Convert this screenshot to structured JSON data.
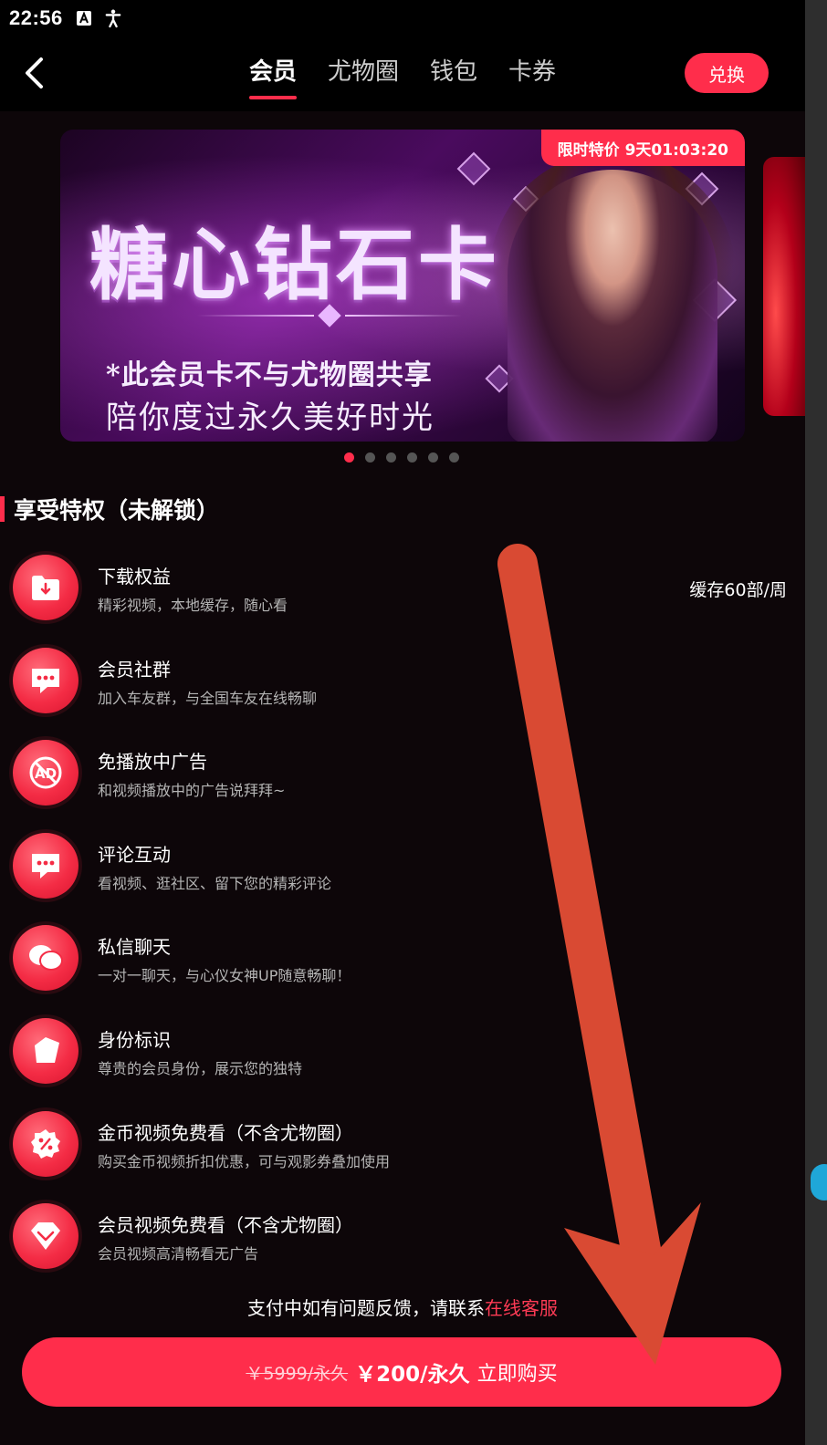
{
  "status_bar": {
    "time": "22:56",
    "icons": [
      "font-icon",
      "accessibility-icon"
    ]
  },
  "header": {
    "tabs": [
      {
        "label": "会员",
        "active": true
      },
      {
        "label": "尤物圈",
        "active": false
      },
      {
        "label": "钱包",
        "active": false
      },
      {
        "label": "卡券",
        "active": false
      }
    ],
    "redeem_label": "兑换"
  },
  "banner": {
    "promo_badge": "限时特价 9天01:03:20",
    "title": "糖心钻石卡",
    "line1": "*此会员卡不与尤物圈共享",
    "line2": "陪你度过永久美好时光",
    "dot_count": 6,
    "active_dot": 0
  },
  "privileges": {
    "section_title": "享受特权（未解锁）",
    "items": [
      {
        "title": "下载权益",
        "desc": "精彩视频，本地缓存，随心看",
        "extra": "缓存60部/周",
        "icon": "download-folder-icon"
      },
      {
        "title": "会员社群",
        "desc": "加入车友群，与全国车友在线畅聊",
        "extra": "",
        "icon": "chat-bubble-icon"
      },
      {
        "title": "免播放中广告",
        "desc": "和视频播放中的广告说拜拜~",
        "extra": "",
        "icon": "ad-icon"
      },
      {
        "title": "评论互动",
        "desc": "看视频、逛社区、留下您的精彩评论",
        "extra": "",
        "icon": "comment-icon"
      },
      {
        "title": "私信聊天",
        "desc": "一对一聊天，与心仪女神UP随意畅聊！",
        "extra": "",
        "icon": "message-icon"
      },
      {
        "title": "身份标识",
        "desc": "尊贵的会员身份，展示您的独特",
        "extra": "",
        "icon": "badge-icon"
      },
      {
        "title": "金币视频免费看（不含尤物圈）",
        "desc": "购买金币视频折扣优惠，可与观影券叠加使用",
        "extra": "",
        "icon": "coupon-icon"
      },
      {
        "title": "会员视频免费看（不含尤物圈）",
        "desc": "会员视频高清畅看无广告",
        "extra": "",
        "icon": "diamond-icon"
      }
    ]
  },
  "footer": {
    "support_text": "支付中如有问题反馈，请联系",
    "support_link": "在线客服",
    "old_price": "￥5999/永久",
    "new_price": "￥200/永久",
    "buy_label": "立即购买"
  },
  "colors": {
    "accent": "#ff2d4b",
    "background": "#0d0609",
    "annotation_arrow": "#d94a33"
  }
}
